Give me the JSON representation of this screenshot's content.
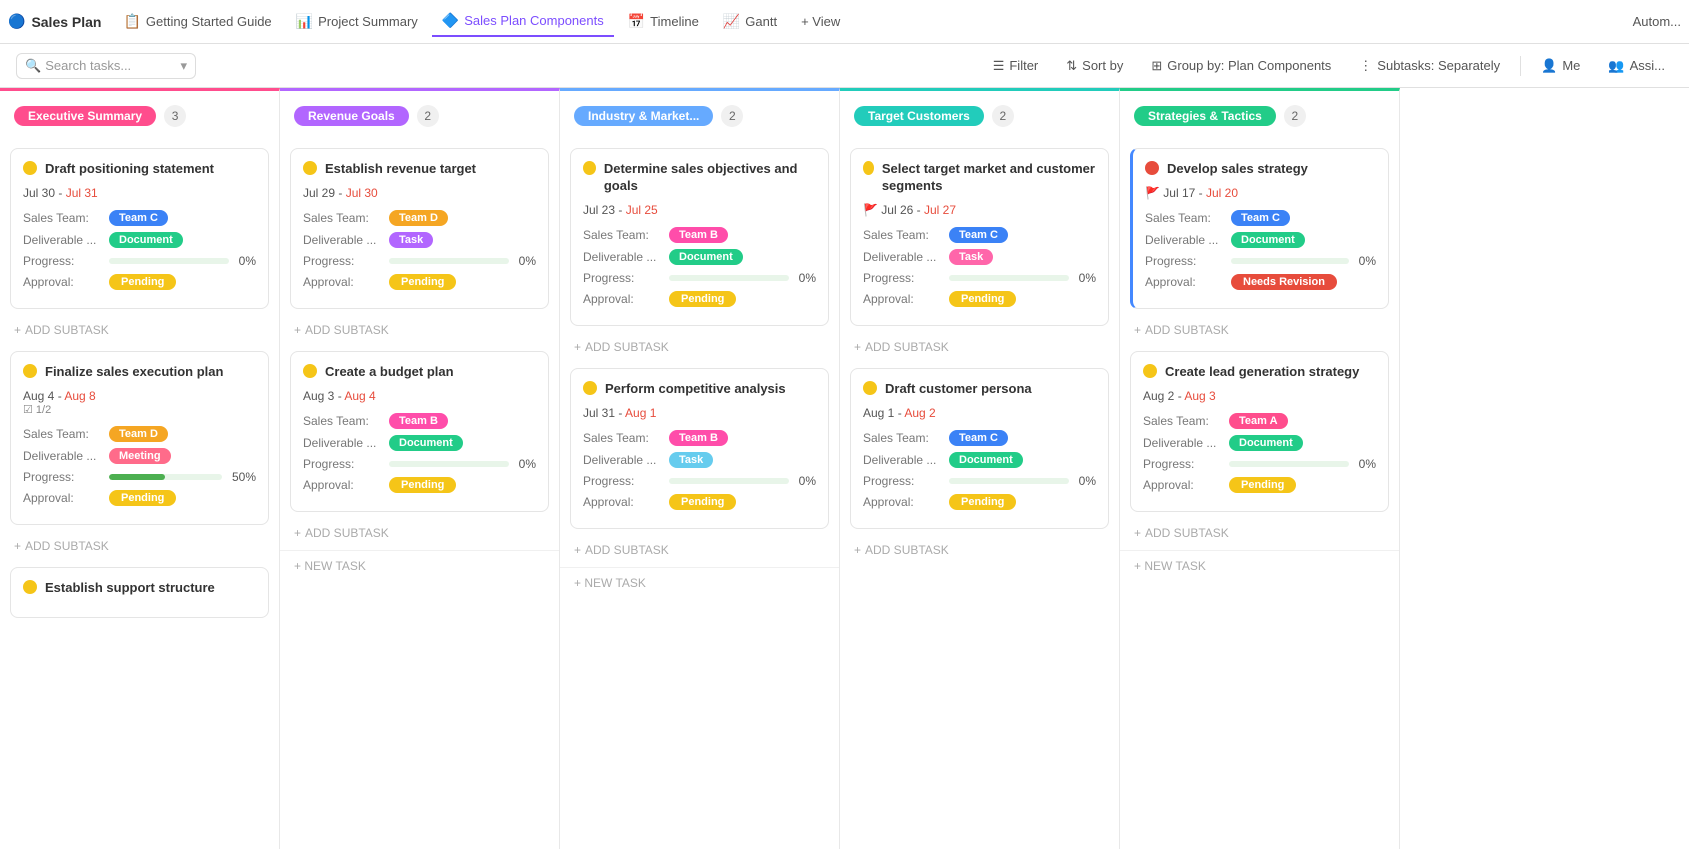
{
  "app": {
    "title": "Sales Plan",
    "tabs": [
      {
        "id": "getting-started",
        "label": "Getting Started Guide",
        "icon": "📋",
        "active": false
      },
      {
        "id": "project-summary",
        "label": "Project Summary",
        "icon": "📊",
        "active": false
      },
      {
        "id": "sales-plan-components",
        "label": "Sales Plan Components",
        "icon": "🔷",
        "active": true
      },
      {
        "id": "timeline",
        "label": "Timeline",
        "icon": "📅",
        "active": false
      },
      {
        "id": "gantt",
        "label": "Gantt",
        "icon": "📈",
        "active": false
      },
      {
        "id": "view",
        "label": "+ View",
        "active": false
      }
    ],
    "auto_label": "Autom..."
  },
  "toolbar": {
    "search_placeholder": "Search tasks...",
    "filter_label": "Filter",
    "sort_label": "Sort by",
    "group_label": "Group by: Plan Components",
    "subtasks_label": "Subtasks: Separately",
    "me_label": "Me",
    "assign_label": "Assi..."
  },
  "columns": [
    {
      "id": "exec",
      "badge_label": "Executive Summary",
      "badge_color": "#ff4d8d",
      "count": 3,
      "border_class": "col-exec",
      "cards": [
        {
          "id": "c1",
          "title": "Draft positioning statement",
          "date_start": "Jul 30",
          "date_end": "Jul 31",
          "date_end_color": "red",
          "flag": false,
          "team_label": "Sales Team:",
          "team_badge": "Team C",
          "team_color": "#3b82f6",
          "deliverable_label": "Deliverable ...",
          "deliverable_badge": "Document",
          "deliverable_color": "#22cc88",
          "progress": 0,
          "approval_badge": "Pending",
          "approval_color": "#f5c518",
          "dot": "yellow",
          "left_border": false
        },
        {
          "id": "c2",
          "title": "Finalize sales execution plan",
          "date_start": "Aug 4",
          "date_end": "Aug 8",
          "date_end_color": "red",
          "flag": false,
          "subtask_count": "1/2",
          "team_label": "Sales Team:",
          "team_badge": "Team D",
          "team_color": "#f5a623",
          "deliverable_label": "Deliverable ...",
          "deliverable_badge": "Meeting",
          "deliverable_color": "#ff6b8a",
          "progress": 50,
          "approval_badge": "Pending",
          "approval_color": "#f5c518",
          "dot": "yellow",
          "left_border": false
        },
        {
          "id": "c3",
          "title": "Establish support structure",
          "date_start": "",
          "date_end": "",
          "dot": "yellow",
          "partial": true,
          "left_border": false
        }
      ]
    },
    {
      "id": "revenue",
      "badge_label": "Revenue Goals",
      "badge_color": "#b266ff",
      "count": 2,
      "border_class": "col-revenue",
      "cards": [
        {
          "id": "c4",
          "title": "Establish revenue target",
          "date_start": "Jul 29",
          "date_end": "Jul 30",
          "date_end_color": "red",
          "flag": false,
          "team_label": "Sales Team:",
          "team_badge": "Team D",
          "team_color": "#f5a623",
          "deliverable_label": "Deliverable ...",
          "deliverable_badge": "Task",
          "deliverable_color": "#b266ff",
          "progress": 0,
          "approval_badge": "Pending",
          "approval_color": "#f5c518",
          "dot": "yellow",
          "left_border": false
        },
        {
          "id": "c5",
          "title": "Create a budget plan",
          "date_start": "Aug 3",
          "date_end": "Aug 4",
          "date_end_color": "red",
          "flag": false,
          "team_label": "Sales Team:",
          "team_badge": "Team B",
          "team_color": "#ff4daa",
          "deliverable_label": "Deliverable ...",
          "deliverable_badge": "Document",
          "deliverable_color": "#22cc88",
          "progress": 0,
          "approval_badge": "Pending",
          "approval_color": "#f5c518",
          "dot": "yellow",
          "left_border": false
        }
      ],
      "new_task_label": "+ NEW TASK"
    },
    {
      "id": "industry",
      "badge_label": "Industry & Market...",
      "badge_color": "#66aaff",
      "count": 2,
      "border_class": "col-industry",
      "cards": [
        {
          "id": "c6",
          "title": "Determine sales objectives and goals",
          "date_start": "Jul 23",
          "date_end": "Jul 25",
          "date_end_color": "red",
          "flag": false,
          "team_label": "Sales Team:",
          "team_badge": "Team B",
          "team_color": "#ff4daa",
          "deliverable_label": "Deliverable ...",
          "deliverable_badge": "Document",
          "deliverable_color": "#22cc88",
          "progress": 0,
          "approval_badge": "Pending",
          "approval_color": "#f5c518",
          "dot": "yellow",
          "left_border": false
        },
        {
          "id": "c7",
          "title": "Perform competitive analysis",
          "date_start": "Jul 31",
          "date_end": "Aug 1",
          "date_end_color": "red",
          "flag": false,
          "team_label": "Sales Team:",
          "team_badge": "Team B",
          "team_color": "#ff4daa",
          "deliverable_label": "Deliverable ...",
          "deliverable_badge": "Task",
          "deliverable_color": "#66ccee",
          "progress": 0,
          "approval_badge": "Pending",
          "approval_color": "#f5c518",
          "dot": "yellow",
          "left_border": false
        }
      ],
      "new_task_label": "+ NEW TASK"
    },
    {
      "id": "target",
      "badge_label": "Target Customers",
      "badge_color": "#22ccbb",
      "count": 2,
      "border_class": "col-target",
      "cards": [
        {
          "id": "c8",
          "title": "Select target market and customer segments",
          "date_start": "Jul 26",
          "date_end": "Jul 27",
          "date_end_color": "red",
          "flag": true,
          "team_label": "Sales Team:",
          "team_badge": "Team C",
          "team_color": "#3b82f6",
          "deliverable_label": "Deliverable ...",
          "deliverable_badge": "Task",
          "deliverable_color": "#ff66aa",
          "progress": 0,
          "approval_badge": "Pending",
          "approval_color": "#f5c518",
          "dot": "yellow",
          "left_border": false
        },
        {
          "id": "c9",
          "title": "Draft customer persona",
          "date_start": "Aug 1",
          "date_end": "Aug 2",
          "date_end_color": "red",
          "flag": false,
          "team_label": "Sales Team:",
          "team_badge": "Team C",
          "team_color": "#3b82f6",
          "deliverable_label": "Deliverable ...",
          "deliverable_badge": "Document",
          "deliverable_color": "#22cc88",
          "progress": 0,
          "approval_badge": "Pending",
          "approval_color": "#f5c518",
          "dot": "yellow",
          "left_border": false
        }
      ]
    },
    {
      "id": "strategies",
      "badge_label": "Strategies & Tactics",
      "badge_color": "#22cc88",
      "count": 2,
      "border_class": "col-strategies",
      "cards": [
        {
          "id": "c10",
          "title": "Develop sales strategy",
          "date_start": "Jul 17",
          "date_end": "Jul 20",
          "date_end_color": "red",
          "flag_red": true,
          "team_label": "Sales Team:",
          "team_badge": "Team C",
          "team_color": "#3b82f6",
          "deliverable_label": "Deliverable ...",
          "deliverable_badge": "Document",
          "deliverable_color": "#22cc88",
          "progress": 0,
          "approval_badge": "Needs Revision",
          "approval_color": "#e74c3c",
          "dot": "red",
          "left_border": true
        },
        {
          "id": "c11",
          "title": "Create lead generation strategy",
          "date_start": "Aug 2",
          "date_end": "Aug 3",
          "date_end_color": "red",
          "flag": false,
          "team_label": "Sales Team:",
          "team_badge": "Team A",
          "team_color": "#ff4d8d",
          "deliverable_label": "Deliverable ...",
          "deliverable_badge": "Document",
          "deliverable_color": "#22cc88",
          "progress": 0,
          "approval_badge": "Pending",
          "approval_color": "#f5c518",
          "dot": "yellow",
          "left_border": false
        }
      ],
      "new_task_label": "+ NEW TASK"
    }
  ]
}
